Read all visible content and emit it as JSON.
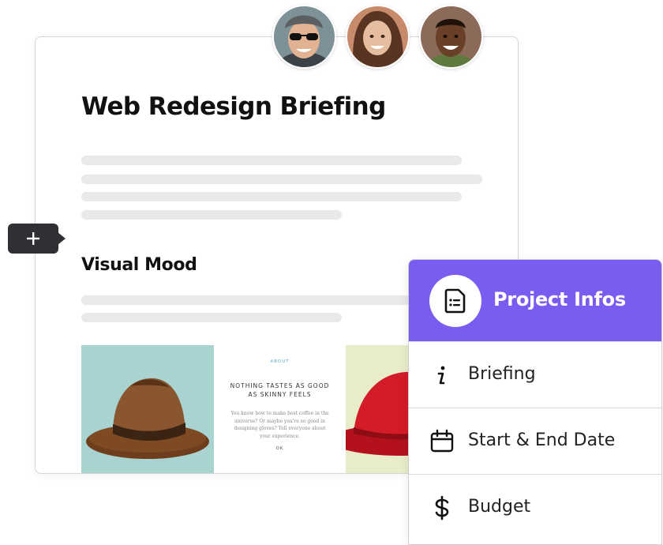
{
  "document": {
    "title": "Web Redesign Briefing",
    "section_title": "Visual Mood"
  },
  "mood_board": {
    "kicker": "ABOUT",
    "heading": "NOTHING TASTES AS GOOD AS SKINNY FEELS",
    "body": "You know how to make best coffee in the universe? Or maybe you're so good in designing gloves? Tell everyone about your experience.",
    "ok": "OK"
  },
  "collaborators": [
    {
      "icon": "avatar-man-sunglasses"
    },
    {
      "icon": "avatar-woman-smiling"
    },
    {
      "icon": "avatar-man-smiling"
    }
  ],
  "project_panel": {
    "title": "Project Infos",
    "accent_color": "#7b5cf0",
    "items": [
      {
        "label": "Briefing",
        "icon": "info-icon"
      },
      {
        "label": "Start & End Date",
        "icon": "calendar-icon"
      },
      {
        "label": "Budget",
        "icon": "dollar-icon"
      }
    ]
  }
}
